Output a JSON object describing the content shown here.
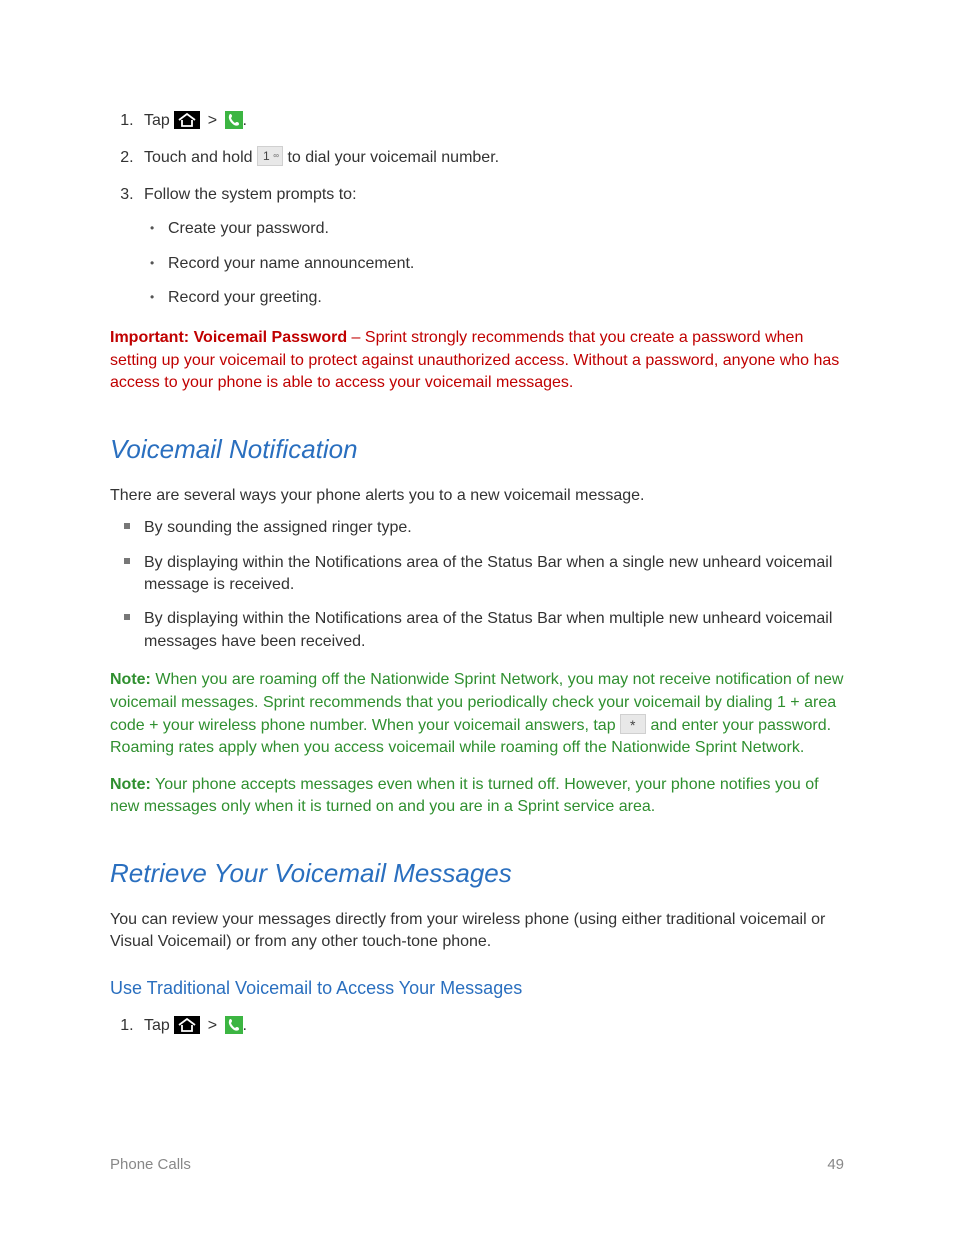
{
  "steps1": {
    "tap_word": "Tap",
    "gt": ">",
    "period": ".",
    "s2a": "Touch and hold ",
    "s2b": " to dial your voicemail number.",
    "s3": "Follow the system prompts to:",
    "s3a": "Create your password.",
    "s3b": "Record your name announcement.",
    "s3c": "Record your greeting."
  },
  "important": {
    "label": "Important:",
    "title": "Voicemail Password",
    "body": " – Sprint strongly recommends that you create a password when setting up your voicemail to protect against unauthorized access. Without a password, anyone who has access to your phone is able to access your voicemail messages."
  },
  "h2_notification": "Voicemail Notification",
  "p_notification_intro": "There are several ways your phone alerts you to a new voicemail message.",
  "alerts": {
    "a1": "By sounding the assigned ringer type.",
    "a2": "By displaying within the Notifications area of the Status Bar when a single new unheard voicemail message is received.",
    "a3": "By displaying within the Notifications area of the Status Bar when multiple new unheard voicemail messages have been received."
  },
  "note1": {
    "label": "Note:",
    "part1": "  When you are roaming off the Nationwide Sprint Network, you may not receive notification of new voicemail messages. Sprint recommends that you periodically check your voicemail by dialing 1 + area code + your wireless phone number. When your voicemail answers, tap ",
    "part2": " and enter your password. Roaming rates apply when you access voicemail while roaming off the Nationwide Sprint Network."
  },
  "note2": {
    "label": "Note:",
    "body": "  Your phone accepts messages even when it is turned off. However, your phone notifies you of new messages only when it is turned on and you are in a Sprint service area."
  },
  "h2_retrieve": "Retrieve Your Voicemail Messages",
  "p_retrieve_intro": "You can review your messages directly from your wireless phone (using either traditional voicemail or Visual Voicemail) or from any other touch-tone phone.",
  "h3_traditional": "Use Traditional Voicemail to Access Your Messages",
  "footer": {
    "section": "Phone Calls",
    "page": "49"
  }
}
